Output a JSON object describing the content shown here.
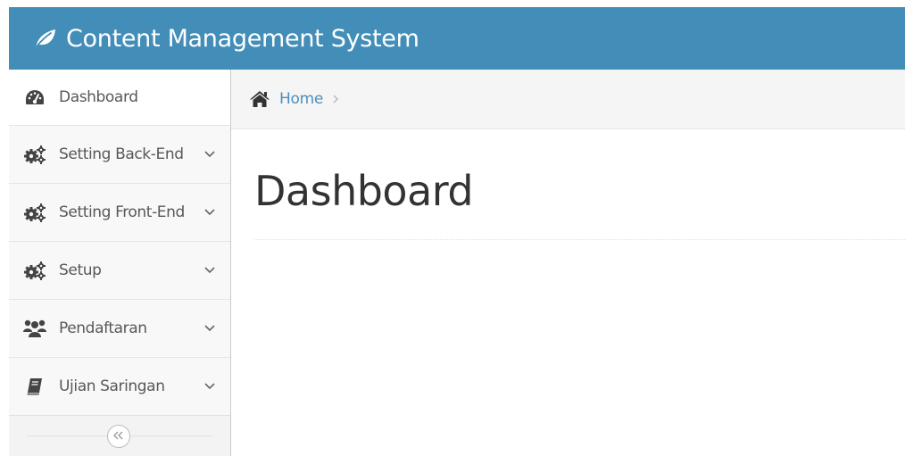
{
  "app": {
    "brand_title": "Content Management System",
    "brand_icon": "leaf-icon",
    "navbar_color": "#438eb9"
  },
  "sidebar": {
    "items": [
      {
        "label": "Dashboard",
        "icon": "tachometer-icon",
        "active": true,
        "has_submenu": false
      },
      {
        "label": "Setting Back-End",
        "icon": "cogs-icon",
        "active": false,
        "has_submenu": true
      },
      {
        "label": "Setting Front-End",
        "icon": "cogs-icon",
        "active": false,
        "has_submenu": true
      },
      {
        "label": "Setup",
        "icon": "cogs-icon",
        "active": false,
        "has_submenu": true
      },
      {
        "label": "Pendaftaran",
        "icon": "users-icon",
        "active": false,
        "has_submenu": true
      },
      {
        "label": "Ujian Saringan",
        "icon": "book-icon",
        "active": false,
        "has_submenu": true
      }
    ],
    "collapse_icon": "double-angle-left-icon"
  },
  "breadcrumb": {
    "items": [
      {
        "label": "Home",
        "icon": "home-icon"
      }
    ],
    "separator_icon": "chevron-right-icon",
    "link_color": "#4c8fbd"
  },
  "page": {
    "title": "Dashboard"
  }
}
